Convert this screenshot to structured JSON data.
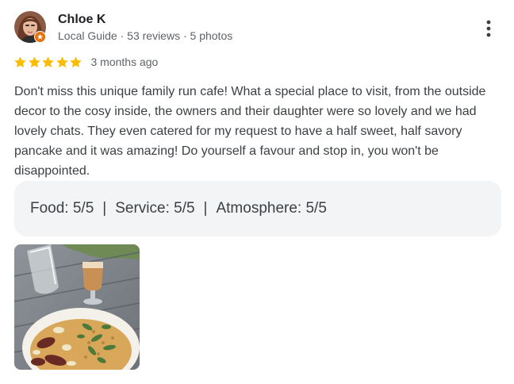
{
  "reviewer": {
    "name": "Chloe K",
    "meta": "Local Guide · 53 reviews · 5 photos",
    "avatar_icon": "avatar-photo",
    "badge_icon": "local-guide-star-icon",
    "badge_color": "#e8710a"
  },
  "rating": {
    "stars": 5,
    "max": 5,
    "star_color": "#fbbc04",
    "date": "3 months ago"
  },
  "review_text": "Don't miss this unique family run cafe! What a special place to visit, from the outside decor to the cosy inside, the owners and their daughter were so lovely and we had lovely chats. They even catered for my request to have a half sweet, half savory pancake and it was amazing! Do yourself a favour and stop in, you won't be disappointed.",
  "sub_ratings": [
    {
      "label": "Food: 5/5"
    },
    {
      "label": "Service: 5/5"
    },
    {
      "label": "Atmosphere: 5/5"
    }
  ],
  "separator": "|",
  "menu_icon": "more-vert-icon",
  "photos": [
    {
      "subject": "pancake-and-drinks-on-table"
    }
  ]
}
